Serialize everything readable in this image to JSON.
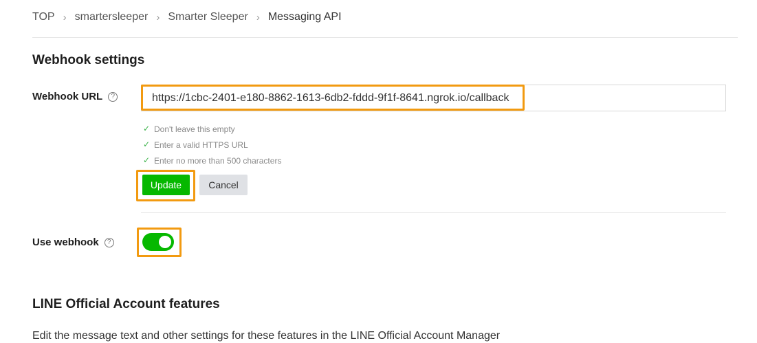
{
  "breadcrumb": {
    "items": [
      "TOP",
      "smartersleeper",
      "Smarter Sleeper",
      "Messaging API"
    ]
  },
  "webhook_settings": {
    "title": "Webhook settings",
    "url_label": "Webhook URL",
    "url_value": "https://1cbc-2401-e180-8862-1613-6db2-fddd-9f1f-8641.ngrok.io/callback",
    "checks": [
      "Don't leave this empty",
      "Enter a valid HTTPS URL",
      "Enter no more than 500 characters"
    ],
    "update_label": "Update",
    "cancel_label": "Cancel",
    "use_webhook_label": "Use webhook",
    "use_webhook_enabled": true
  },
  "oa_features": {
    "title": "LINE Official Account features",
    "description": "Edit the message text and other settings for these features in the LINE Official Account Manager"
  },
  "colors": {
    "accent_green": "#06b800",
    "highlight_orange": "#f29a10",
    "check_green": "#3cb34a"
  },
  "icons": [
    "chevron-right-icon",
    "help-circle-icon",
    "check-icon"
  ]
}
